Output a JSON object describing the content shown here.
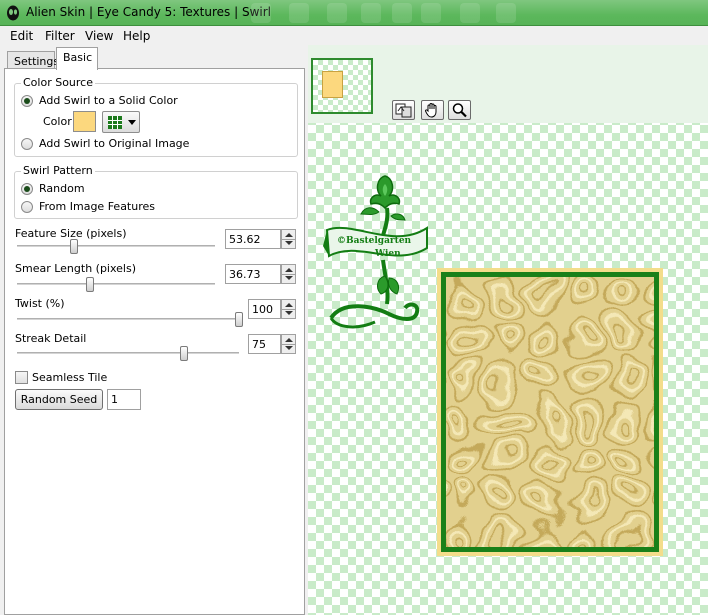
{
  "window": {
    "title": "Alien Skin | Eye Candy 5: Textures | Swirl"
  },
  "menu": [
    "Edit",
    "Filter",
    "View",
    "Help"
  ],
  "tabs": [
    {
      "label": "Settings",
      "active": false
    },
    {
      "label": "Basic",
      "active": true
    }
  ],
  "color_source": {
    "title": "Color Source",
    "option_solid": "Add Swirl to a Solid Color",
    "color_label": "Color",
    "color_value": "#fcd87e",
    "option_original": "Add Swirl to Original Image",
    "selected": "solid"
  },
  "swirl_pattern": {
    "title": "Swirl Pattern",
    "option_random": "Random",
    "option_features": "From Image Features",
    "selected": "random"
  },
  "sliders": {
    "feature_size": {
      "label": "Feature Size (pixels)",
      "value": "53.62",
      "fraction": 0.29
    },
    "smear_length": {
      "label": "Smear Length (pixels)",
      "value": "36.73",
      "fraction": 0.37
    },
    "twist": {
      "label": "Twist (%)",
      "value": "100",
      "fraction": 1.0
    },
    "streak_detail": {
      "label": "Streak Detail",
      "value": "75",
      "fraction": 0.75
    }
  },
  "seamless_tile": {
    "label": "Seamless Tile",
    "checked": false
  },
  "random_seed": {
    "button_label": "Random Seed",
    "value": "1"
  },
  "tools": [
    "preview-toggle-icon",
    "hand-icon",
    "zoom-icon"
  ],
  "watermark": {
    "line1": "©Bastelgarten",
    "line2": "Wien"
  },
  "colors": {
    "frame_green": "#198019",
    "accent_green": "#5cb85c",
    "swirl_base": "#d8c27a"
  }
}
